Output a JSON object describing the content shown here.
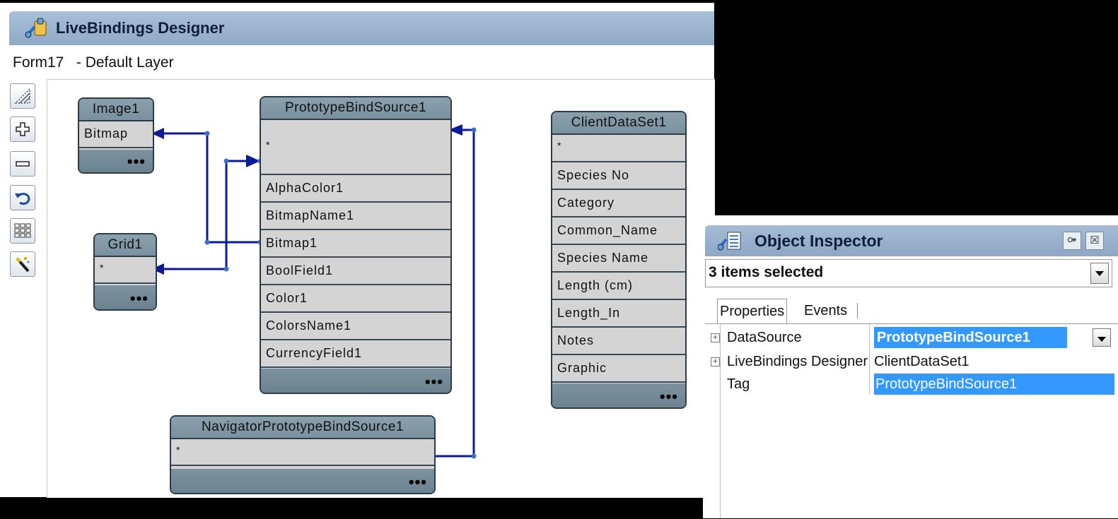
{
  "designer": {
    "title": "LiveBindings Designer",
    "form": "Form17",
    "layer": "- Default Layer",
    "toolbar": [
      "zoom-fit-icon",
      "zoom-in-icon",
      "zoom-out-icon",
      "undo-icon",
      "grid-layout-icon",
      "magic-wand-icon"
    ],
    "nodes": {
      "image1": {
        "name": "Image1",
        "fields": [
          "Bitmap"
        ],
        "more": "•••"
      },
      "grid1": {
        "name": "Grid1",
        "fields": [
          "*"
        ],
        "more": "•••"
      },
      "pbs": {
        "name": "PrototypeBindSource1",
        "fields": [
          "*",
          "AlphaColor1",
          "BitmapName1",
          "Bitmap1",
          "BoolField1",
          "Color1",
          "ColorsName1",
          "CurrencyField1"
        ],
        "more": "•••"
      },
      "cds": {
        "name": "ClientDataSet1",
        "fields": [
          "*",
          "Species No",
          "Category",
          "Common_Name",
          "Species Name",
          "Length (cm)",
          "Length_In",
          "Notes",
          "Graphic"
        ],
        "more": "•••"
      },
      "nav": {
        "name": "NavigatorPrototypeBindSource1",
        "fields": [
          "*"
        ],
        "more": "•••"
      }
    },
    "link_color": "#0a1a9a"
  },
  "inspector": {
    "title": "Object Inspector",
    "pin_label": "⚩",
    "close_label": "☒",
    "selection": "3 items selected",
    "tabs": [
      "Properties",
      "Events"
    ],
    "properties": [
      {
        "name": "DataSource",
        "value": "PrototypeBindSource1",
        "expandable": true
      },
      {
        "name": "LiveBindings Designer",
        "value": "ClientDataSet1",
        "expandable": true
      },
      {
        "name": "Tag",
        "value": "PrototypeBindSource1",
        "expandable": false
      }
    ],
    "highlight_color": "#3399ff"
  }
}
